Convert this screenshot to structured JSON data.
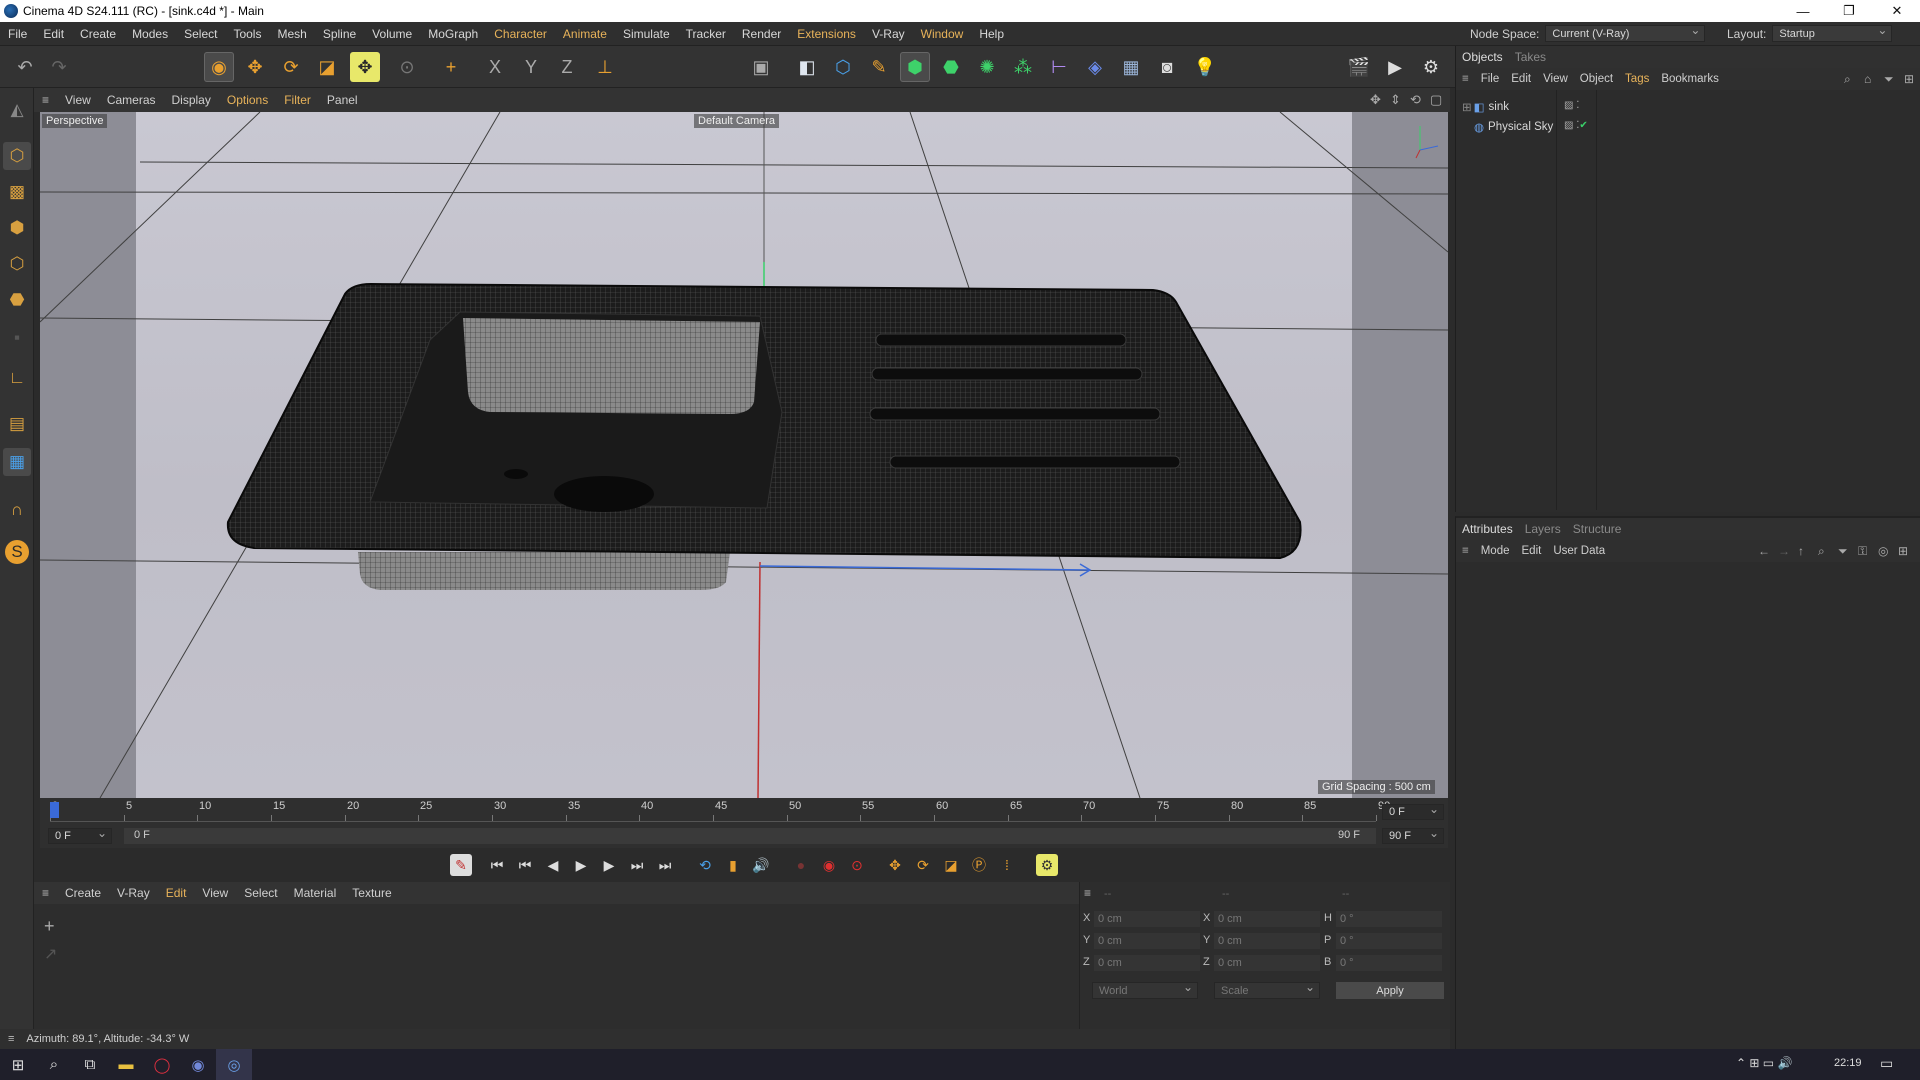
{
  "window": {
    "title": "Cinema 4D S24.111 (RC) - [sink.c4d *] - Main",
    "minimize": "—",
    "maximize": "❐",
    "close": "✕"
  },
  "menu": {
    "items": [
      "File",
      "Edit",
      "Create",
      "Modes",
      "Select",
      "Tools",
      "Mesh",
      "Spline",
      "Volume",
      "MoGraph",
      "Character",
      "Animate",
      "Simulate",
      "Tracker",
      "Render",
      "Extensions",
      "V-Ray",
      "Window",
      "Help"
    ],
    "highlighted": [
      "Character",
      "Animate",
      "Extensions"
    ],
    "node_space_label": "Node Space:",
    "node_space_value": "Current (V-Ray)",
    "layout_label": "Layout:",
    "layout_value": "Startup"
  },
  "viewport": {
    "menu": [
      "View",
      "Cameras",
      "Display",
      "Options",
      "Filter",
      "Panel"
    ],
    "highlighted": [
      "Options",
      "Filter"
    ],
    "view_name": "Perspective",
    "camera_label": "Default Camera",
    "grid_spacing": "Grid Spacing : 500 cm"
  },
  "timeline": {
    "ticks": [
      "0",
      "5",
      "10",
      "15",
      "20",
      "25",
      "30",
      "35",
      "40",
      "45",
      "50",
      "55",
      "60",
      "65",
      "70",
      "75",
      "80",
      "85",
      "90"
    ],
    "current_frame": "0 F",
    "start_frame": "0 F",
    "range_start": "0 F",
    "range_end": "90 F",
    "end_frame": "90 F",
    "max_frame": "90 F"
  },
  "materials": {
    "menu": [
      "Create",
      "V-Ray",
      "Edit",
      "View",
      "Select",
      "Material",
      "Texture"
    ],
    "highlighted": [
      "Edit"
    ]
  },
  "coordinates": {
    "headers": [
      "--",
      "--",
      "--"
    ],
    "rows": [
      {
        "l1": "X",
        "v1": "0 cm",
        "l2": "X",
        "v2": "0 cm",
        "l3": "H",
        "v3": "0 °"
      },
      {
        "l1": "Y",
        "v1": "0 cm",
        "l2": "Y",
        "v2": "0 cm",
        "l3": "P",
        "v3": "0 °"
      },
      {
        "l1": "Z",
        "v1": "0 cm",
        "l2": "Z",
        "v2": "0 cm",
        "l3": "B",
        "v3": "0 °"
      }
    ],
    "space": "World",
    "mode": "Scale",
    "apply": "Apply"
  },
  "status": {
    "text": "Azimuth: 89.1°, Altitude: -34.3°  W"
  },
  "objects_panel": {
    "tabs": [
      "Objects",
      "Takes"
    ],
    "menu": [
      "File",
      "Edit",
      "View",
      "Object",
      "Tags",
      "Bookmarks"
    ],
    "highlighted": [
      "Tags"
    ],
    "items": [
      {
        "name": "sink"
      },
      {
        "name": "Physical Sky"
      }
    ]
  },
  "attributes_panel": {
    "tabs": [
      "Attributes",
      "Layers",
      "Structure"
    ],
    "menu": [
      "Mode",
      "Edit",
      "User Data"
    ]
  },
  "taskbar": {
    "time": "22:19"
  }
}
